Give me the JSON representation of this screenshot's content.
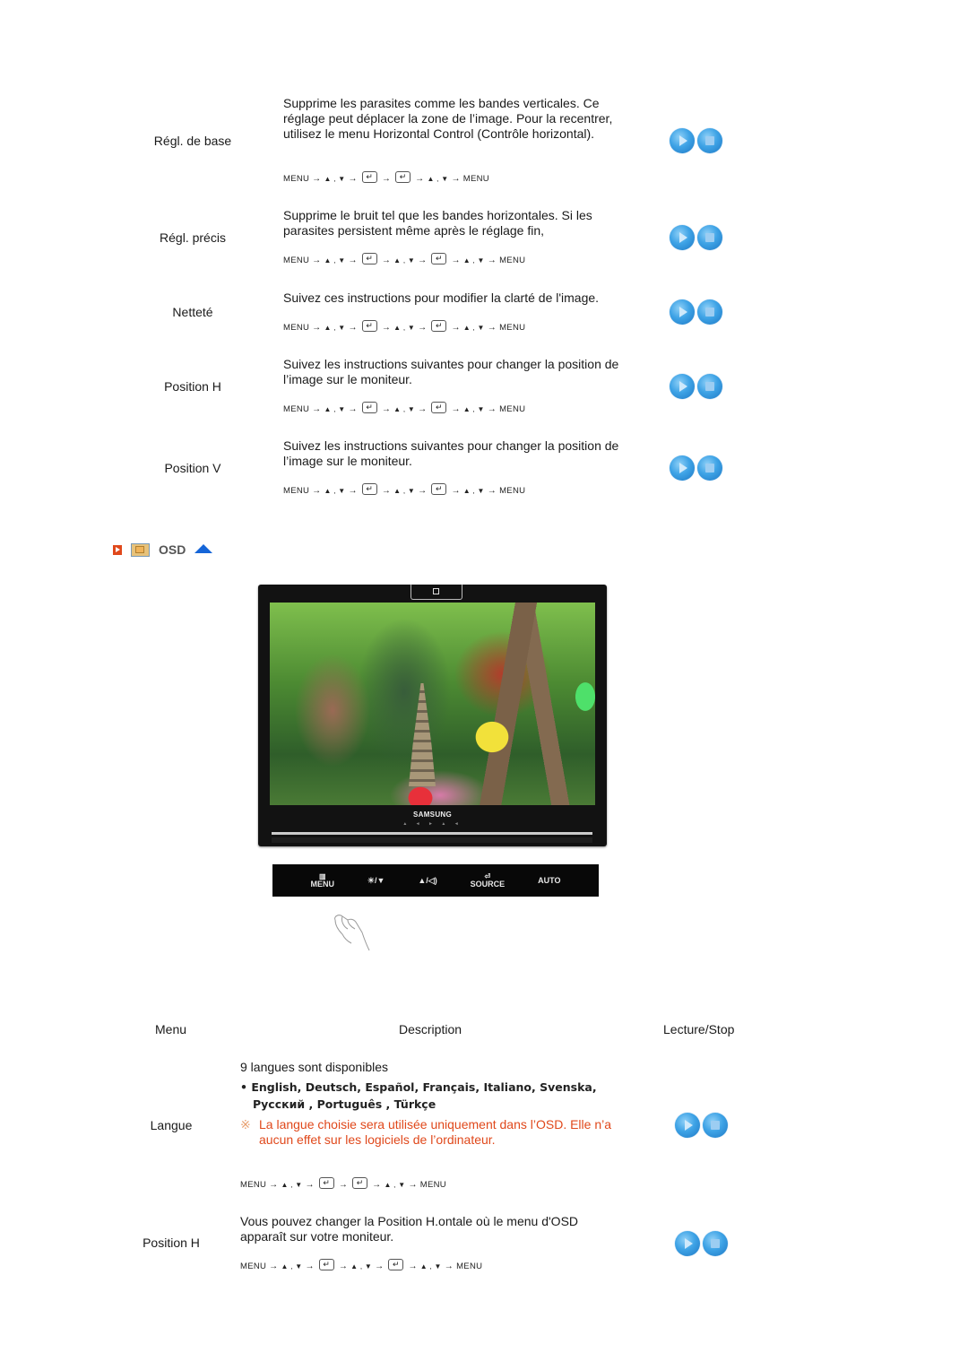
{
  "sections": [
    {
      "label": "Régl. de base",
      "description": "Supprime les parasites comme les bandes verticales. Ce réglage peut déplacer la zone de l’image. Pour la recentrer, utilisez le menu Horizontal Control (Contrôle horizontal).",
      "sequence": [
        "MENU",
        "▲ , ▼",
        "↵",
        "↵",
        "▲ , ▼",
        "MENU"
      ]
    },
    {
      "label": "Régl. précis",
      "description": "Supprime le bruit tel que les bandes horizontales. Si les parasites persistent même après le réglage fin,",
      "sequence": [
        "MENU",
        "▲ , ▼",
        "↵",
        "▲ , ▼",
        "↵",
        "▲ , ▼",
        "MENU"
      ]
    },
    {
      "label": "Netteté",
      "description": "Suivez ces instructions pour modifier la clarté de l'image.",
      "sequence": [
        "MENU",
        "▲ , ▼",
        "↵",
        "▲ , ▼",
        "↵",
        "▲ , ▼",
        "MENU"
      ]
    },
    {
      "label": "Position H",
      "description": "Suivez les instructions suivantes pour changer la position de l’image sur le moniteur.",
      "sequence": [
        "MENU",
        "▲ , ▼",
        "↵",
        "▲ , ▼",
        "↵",
        "▲ , ▼",
        "MENU"
      ]
    },
    {
      "label": "Position V",
      "description": "Suivez les instructions suivantes pour changer la position de l’image sur le moniteur.",
      "sequence": [
        "MENU",
        "▲ , ▼",
        "↵",
        "▲ , ▼",
        "↵",
        "▲ , ▼",
        "MENU"
      ]
    }
  ],
  "osd": {
    "title": "OSD",
    "icons": [
      "section-bullet-icon",
      "osd-image-icon",
      "go-top-arrow-icon"
    ],
    "monitor": {
      "brand": "SAMSUNG",
      "front_leds": "▲ ◄ ► ▲ ◄"
    },
    "control_buttons": [
      {
        "icon": "▥",
        "label": "MENU"
      },
      {
        "icon": "",
        "label": "☀/▼"
      },
      {
        "icon": "",
        "label": "▲/◁)"
      },
      {
        "icon": "⏎",
        "label": "SOURCE"
      },
      {
        "icon": "",
        "label": "AUTO"
      }
    ]
  },
  "table": {
    "headers": {
      "menu": "Menu",
      "description": "Description",
      "play_stop": "Lecture/Stop"
    },
    "rows": [
      {
        "label": "Langue",
        "intro": "9 langues sont disponibles",
        "languages_line1": "• English, Deutsch, Español, Français,  Italiano, Svenska,",
        "languages_line2": "Русский , Português , Türkçe",
        "note_mark": "※",
        "note": "La langue choisie sera utilisée uniquement dans l’OSD. Elle n’a aucun effet sur les logiciels de l’ordinateur.",
        "sequence": [
          "MENU",
          "▲ , ▼",
          "↵",
          "↵",
          "▲ , ▼",
          "MENU"
        ]
      },
      {
        "label": "Position H",
        "description": "Vous pouvez changer la Position H.ontale où le menu d'OSD apparaît sur votre moniteur.",
        "sequence": [
          "MENU",
          "▲ , ▼",
          "↵",
          "▲ , ▼",
          "↵",
          "▲ , ▼",
          "MENU"
        ]
      }
    ]
  },
  "colors": {
    "note_red": "#e0481b",
    "osd_arrow_blue": "#1565d8",
    "button_blue": "#3ea3e6"
  }
}
